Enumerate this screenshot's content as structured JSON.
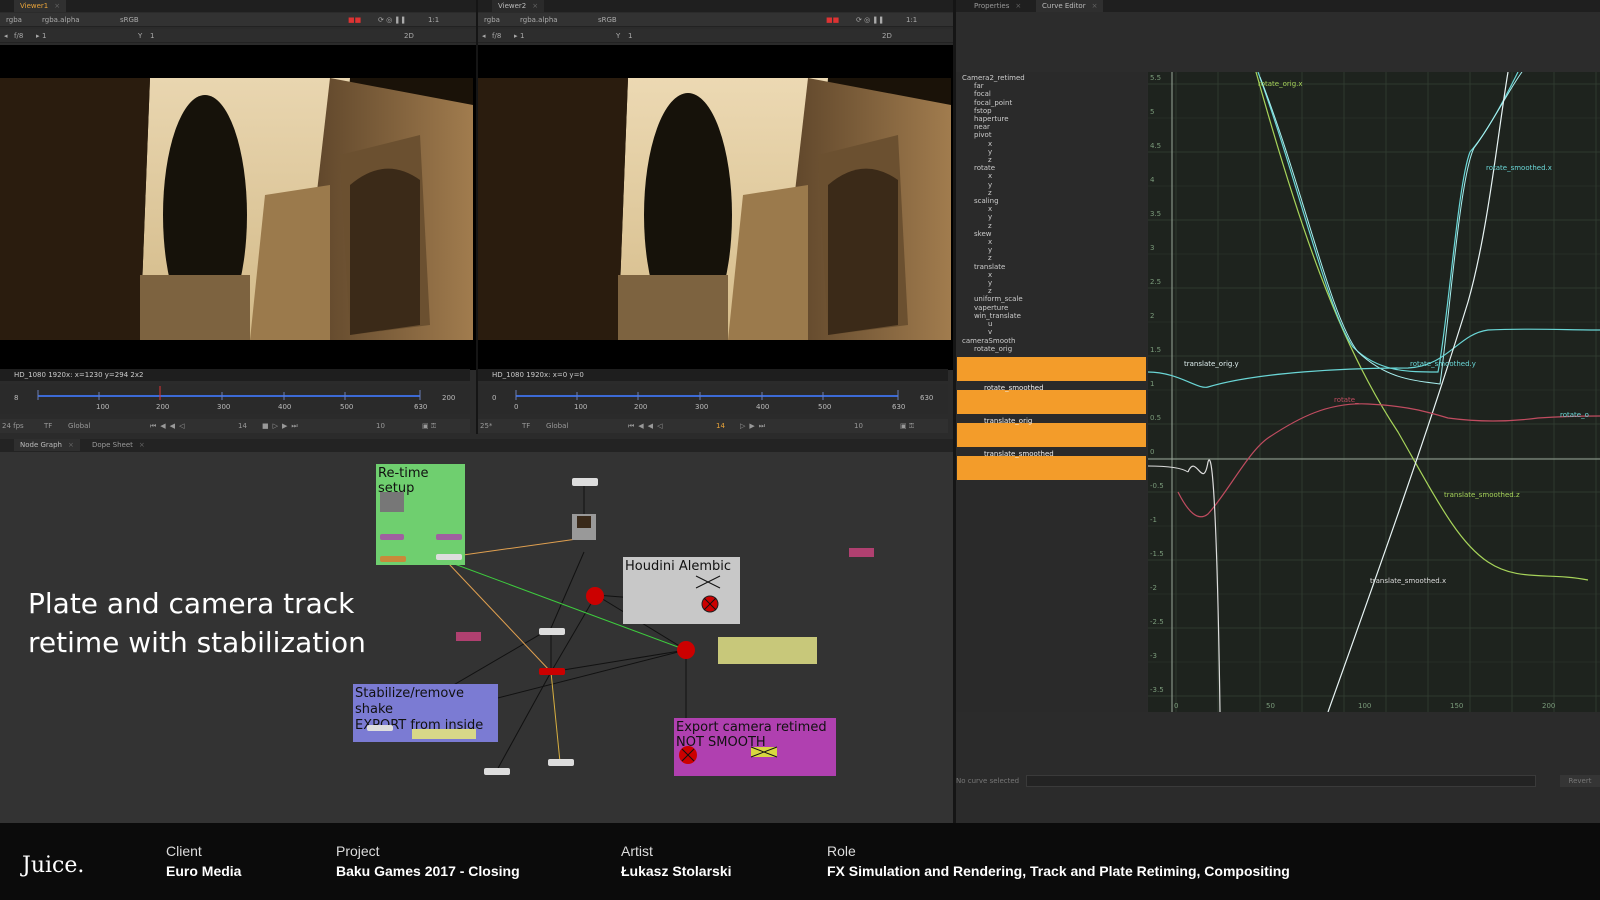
{
  "viewer1": {
    "tab": "Viewer1",
    "channels": "rgba",
    "alpha": "rgba.alpha",
    "colorspace": "sRGB",
    "zoom": "1:1",
    "fstop": "f/8",
    "frame": "1",
    "ylabel": "Y",
    "yval": "1",
    "mode": "2D",
    "info": "HD_1080 1920x:  x=1230 y=294 2x2",
    "fps": "24 fps",
    "tf": "TF",
    "global": "Global",
    "current_frame": "14",
    "step": "10",
    "in": "8",
    "out": "200",
    "ticks": [
      "100",
      "200",
      "300",
      "400",
      "500",
      "630"
    ]
  },
  "viewer2": {
    "tab": "Viewer2",
    "channels": "rgba",
    "alpha": "rgba.alpha",
    "colorspace": "sRGB",
    "zoom": "1:1",
    "fstop": "f/8",
    "frame": "1",
    "ylabel": "Y",
    "yval": "1",
    "mode": "2D",
    "info": "HD_1080 1920x:  x=0 y=0",
    "fps": "25*",
    "tf": "TF",
    "global": "Global",
    "current_frame": "14",
    "step": "10",
    "in": "0",
    "out": "630",
    "ticks": [
      "0",
      "100",
      "200",
      "300",
      "400",
      "500",
      "630"
    ]
  },
  "right_tabs": {
    "properties": "Properties",
    "curve_editor": "Curve Editor"
  },
  "bottom_tabs": {
    "node_graph": "Node Graph",
    "dope_sheet": "Dope Sheet"
  },
  "nodes": {
    "retime": "Re-time setup",
    "houdini": "Houdini Alembic",
    "stabilize_line1": "Stabilize/remove shake",
    "stabilize_line2": "EXPORT from inside",
    "export": "Export camera retimed NOT SMOOTH"
  },
  "caption": {
    "line1": "Plate and camera track",
    "line2": "retime with stabilization"
  },
  "curve_tree": [
    "Camera2_retimed",
    "far",
    "focal",
    "focal_point",
    "fstop",
    "haperture",
    "near",
    "pivot",
    "x",
    "y",
    "z",
    "rotate",
    "x",
    "y",
    "z",
    "scaling",
    "x",
    "y",
    "z",
    "skew",
    "x",
    "y",
    "z",
    "translate",
    "x",
    "y",
    "z",
    "uniform_scale",
    "vaperture",
    "win_translate",
    "u",
    "v",
    "cameraSmooth",
    "rotate_orig"
  ],
  "curve_groups": [
    "rotate_smoothed",
    "translate_orig",
    "translate_smoothed"
  ],
  "curve_labels": {
    "rotate_orig_x": "rotate_orig.x",
    "rotate_smoothed_x": "rotate_smoothed.x",
    "translate_orig_y": "translate_orig.y",
    "rotate_smoothed_y": "rotate_smoothed.y",
    "translate_smoothed_z": "translate_smoothed.z",
    "translate_smoothed_x": "translate_smoothed.x",
    "rotate_orig_cut": "rotate_",
    "rotate_orig_y_cut": "rotate_o"
  },
  "curve_yticks": [
    "5.5",
    "5",
    "4.5",
    "4",
    "3.5",
    "3",
    "2.5",
    "2",
    "1.5",
    "1",
    "0.5",
    "0",
    "-0.5",
    "-1",
    "-1.5",
    "-2",
    "-2.5",
    "-3",
    "-3.5"
  ],
  "curve_xticks": [
    "0",
    "50",
    "100",
    "150",
    "200"
  ],
  "curve_status": "No curve selected",
  "revert": "Revert",
  "footer": {
    "logo": "Juice.",
    "client_label": "Client",
    "client": "Euro Media",
    "project_label": "Project",
    "project": "Baku Games 2017 - Closing",
    "artist_label": "Artist",
    "artist": "Łukasz Stolarski",
    "role_label": "Role",
    "role": "FX Simulation and Rendering, Track and Plate Retiming, Compositing"
  }
}
